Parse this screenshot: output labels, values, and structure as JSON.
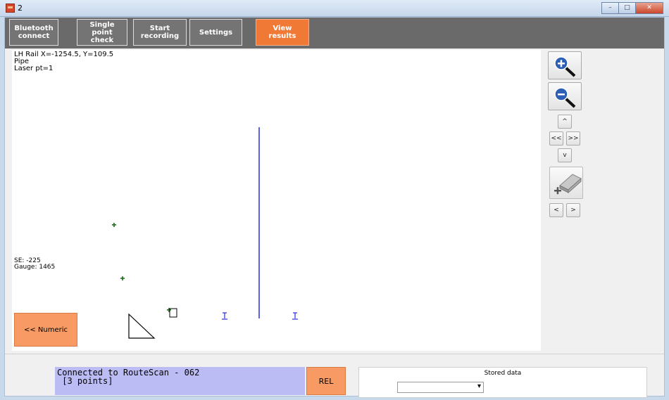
{
  "window": {
    "title": "2",
    "min": "–",
    "max": "□",
    "close": "✕"
  },
  "toolbar": {
    "bt_line1": "Bluetooth",
    "bt_line2": "connect",
    "sp_line1": "Single point",
    "sp_line2": "check",
    "rec_line1": "Start",
    "rec_line2": "recording",
    "settings": "Settings",
    "results": "View results"
  },
  "canvas": {
    "info_line1": "LH Rail X=-1254.5, Y=109.5",
    "info_line2": "Pipe",
    "info_line3": "Laser pt=1",
    "se": "SE: -225",
    "gauge": "Gauge: 1465",
    "numeric_button": "<< Numeric"
  },
  "side": {
    "up": "^",
    "left": "<<",
    "right": ">>",
    "down": "v",
    "prev": "<",
    "next": ">"
  },
  "status": {
    "conn_line1": "Connected to RouteScan - 062",
    "conn_line2": " [3 points]",
    "rel": "REL",
    "stored_label": "Stored data",
    "stored_value": ""
  },
  "colors": {
    "accent": "#f07a35",
    "button_orange": "#f79a64",
    "status_bg": "#bcbcf4",
    "plot_line": "#2a2adb",
    "marker": "#1e6b1e"
  }
}
